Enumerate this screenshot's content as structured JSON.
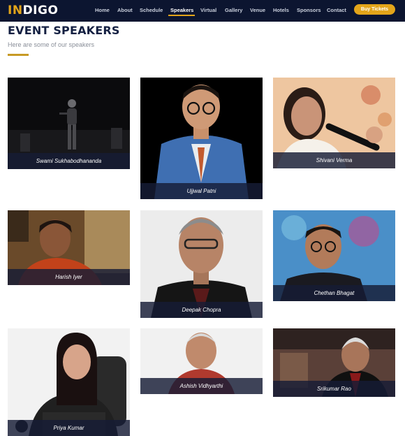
{
  "brand": {
    "logo_accent": "IN",
    "logo_rest": "DIGO"
  },
  "nav": {
    "items": [
      "Home",
      "About",
      "Schedule",
      "Speakers",
      "Virtual",
      "Gallery",
      "Venue",
      "Hotels",
      "Sponsors",
      "Contact"
    ],
    "active": "Speakers",
    "cta_label": "Buy Tickets"
  },
  "header": {
    "title": "EVENT SPEAKERS",
    "subtitle": "Here are some of our speakers"
  },
  "speakers": [
    {
      "name": "Swami Sukhabodhananda"
    },
    {
      "name": "Ujjwal Patni"
    },
    {
      "name": "Shivani Verma"
    },
    {
      "name": "Harish Iyer"
    },
    {
      "name": "Deepak Chopra"
    },
    {
      "name": "Chethan Bhagat"
    },
    {
      "name": "Priya Kumar"
    },
    {
      "name": "Ashish Vidhyarthi"
    },
    {
      "name": "Srikumar Rao"
    }
  ],
  "colors": {
    "navbar_bg": "#0c1530",
    "accent": "#e3a51a",
    "title": "#142042",
    "caption_bg": "#161c36"
  }
}
